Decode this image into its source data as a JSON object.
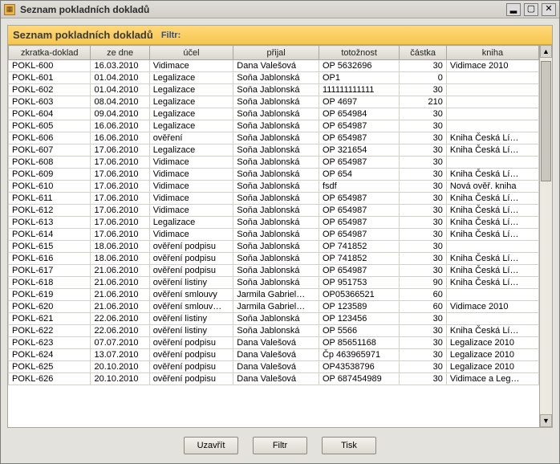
{
  "window": {
    "title": "Seznam pokladních dokladů"
  },
  "panel": {
    "title": "Seznam pokladních dokladů",
    "filter_label": "Filtr:"
  },
  "columns": [
    "zkratka-doklad",
    "ze dne",
    "účel",
    "přijal",
    "totožnost",
    "částka",
    "kniha"
  ],
  "rows": [
    {
      "c0": "POKL-600",
      "c1": "16.03.2010",
      "c2": "Vidimace",
      "c3": "Dana Valešová",
      "c4": "OP 5632696",
      "c5": "30",
      "c6": "Vidimace 2010"
    },
    {
      "c0": "POKL-601",
      "c1": "01.04.2010",
      "c2": "Legalizace",
      "c3": "Soňa Jablonská",
      "c4": "OP1",
      "c5": "0",
      "c6": ""
    },
    {
      "c0": "POKL-602",
      "c1": "01.04.2010",
      "c2": "Legalizace",
      "c3": "Soňa Jablonská",
      "c4": "111111111111",
      "c5": "30",
      "c6": ""
    },
    {
      "c0": "POKL-603",
      "c1": "08.04.2010",
      "c2": "Legalizace",
      "c3": "Soňa Jablonská",
      "c4": "OP 4697",
      "c5": "210",
      "c6": ""
    },
    {
      "c0": "POKL-604",
      "c1": "09.04.2010",
      "c2": "Legalizace",
      "c3": "Soňa Jablonská",
      "c4": "OP 654984",
      "c5": "30",
      "c6": ""
    },
    {
      "c0": "POKL-605",
      "c1": "16.06.2010",
      "c2": "Legalizace",
      "c3": "Soňa Jablonská",
      "c4": "OP 654987",
      "c5": "30",
      "c6": ""
    },
    {
      "c0": "POKL-606",
      "c1": "16.06.2010",
      "c2": "ověření",
      "c3": "Soňa Jablonská",
      "c4": "OP 654987",
      "c5": "30",
      "c6": "Kniha Česká Lí…"
    },
    {
      "c0": "POKL-607",
      "c1": "17.06.2010",
      "c2": "Legalizace",
      "c3": "Soňa Jablonská",
      "c4": "OP 321654",
      "c5": "30",
      "c6": "Kniha Česká Lí…"
    },
    {
      "c0": "POKL-608",
      "c1": "17.06.2010",
      "c2": "Vidimace",
      "c3": "Soňa Jablonská",
      "c4": "OP 654987",
      "c5": "30",
      "c6": ""
    },
    {
      "c0": "POKL-609",
      "c1": "17.06.2010",
      "c2": "Vidimace",
      "c3": "Soňa Jablonská",
      "c4": "OP 654",
      "c5": "30",
      "c6": "Kniha Česká Lí…"
    },
    {
      "c0": "POKL-610",
      "c1": "17.06.2010",
      "c2": "Vidimace",
      "c3": "Soňa Jablonská",
      "c4": "fsdf",
      "c5": "30",
      "c6": "Nová ověř. kniha"
    },
    {
      "c0": "POKL-611",
      "c1": "17.06.2010",
      "c2": "Vidimace",
      "c3": "Soňa Jablonská",
      "c4": "OP 654987",
      "c5": "30",
      "c6": "Kniha Česká Lí…"
    },
    {
      "c0": "POKL-612",
      "c1": "17.06.2010",
      "c2": "Vidimace",
      "c3": "Soňa Jablonská",
      "c4": "OP 654987",
      "c5": "30",
      "c6": "Kniha Česká Lí…"
    },
    {
      "c0": "POKL-613",
      "c1": "17.06.2010",
      "c2": "Legalizace",
      "c3": "Soňa Jablonská",
      "c4": "OP 654987",
      "c5": "30",
      "c6": "Kniha Česká Lí…"
    },
    {
      "c0": "POKL-614",
      "c1": "17.06.2010",
      "c2": "Vidimace",
      "c3": "Soňa Jablonská",
      "c4": "OP 654987",
      "c5": "30",
      "c6": "Kniha Česká Lí…"
    },
    {
      "c0": "POKL-615",
      "c1": "18.06.2010",
      "c2": "ověření podpisu",
      "c3": "Soňa Jablonská",
      "c4": "OP 741852",
      "c5": "30",
      "c6": ""
    },
    {
      "c0": "POKL-616",
      "c1": "18.06.2010",
      "c2": "ověření podpisu",
      "c3": "Soňa Jablonská",
      "c4": "OP 741852",
      "c5": "30",
      "c6": "Kniha Česká Lí…"
    },
    {
      "c0": "POKL-617",
      "c1": "21.06.2010",
      "c2": "ověření podpisu",
      "c3": "Soňa Jablonská",
      "c4": "OP 654987",
      "c5": "30",
      "c6": "Kniha Česká Lí…"
    },
    {
      "c0": "POKL-618",
      "c1": "21.06.2010",
      "c2": "ověření listiny",
      "c3": "Soňa Jablonská",
      "c4": "OP 951753",
      "c5": "90",
      "c6": "Kniha Česká Lí…"
    },
    {
      "c0": "POKL-619",
      "c1": "21.06.2010",
      "c2": "ověření smlouvy",
      "c3": "Jarmila Gabriel…",
      "c4": "OP05366521",
      "c5": "60",
      "c6": ""
    },
    {
      "c0": "POKL-620",
      "c1": "21.06.2010",
      "c2": "ověření smlouv…",
      "c3": "Jarmila Gabriel…",
      "c4": "OP 123589",
      "c5": "60",
      "c6": "Vidimace 2010"
    },
    {
      "c0": "POKL-621",
      "c1": "22.06.2010",
      "c2": "ověření listiny",
      "c3": "Soňa Jablonská",
      "c4": "OP 123456",
      "c5": "30",
      "c6": ""
    },
    {
      "c0": "POKL-622",
      "c1": "22.06.2010",
      "c2": "ověření listiny",
      "c3": "Soňa Jablonská",
      "c4": "OP 5566",
      "c5": "30",
      "c6": "Kniha Česká Lí…"
    },
    {
      "c0": "POKL-623",
      "c1": "07.07.2010",
      "c2": "ověření podpisu",
      "c3": "Dana Valešová",
      "c4": "OP 85651168",
      "c5": "30",
      "c6": "Legalizace 2010"
    },
    {
      "c0": "POKL-624",
      "c1": "13.07.2010",
      "c2": "ověření podpisu",
      "c3": "Dana Valešová",
      "c4": "Čp 463965971",
      "c5": "30",
      "c6": "Legalizace 2010"
    },
    {
      "c0": "POKL-625",
      "c1": "20.10.2010",
      "c2": "ověření podpisu",
      "c3": "Dana Valešová",
      "c4": "OP43538796",
      "c5": "30",
      "c6": "Legalizace 2010"
    },
    {
      "c0": "POKL-626",
      "c1": "20.10.2010",
      "c2": "ověření podpisu",
      "c3": "Dana Valešová",
      "c4": "OP 687454989",
      "c5": "30",
      "c6": "Vidimace a Leg…"
    }
  ],
  "buttons": {
    "close": "Uzavřít",
    "filter": "Filtr",
    "print": "Tisk"
  }
}
